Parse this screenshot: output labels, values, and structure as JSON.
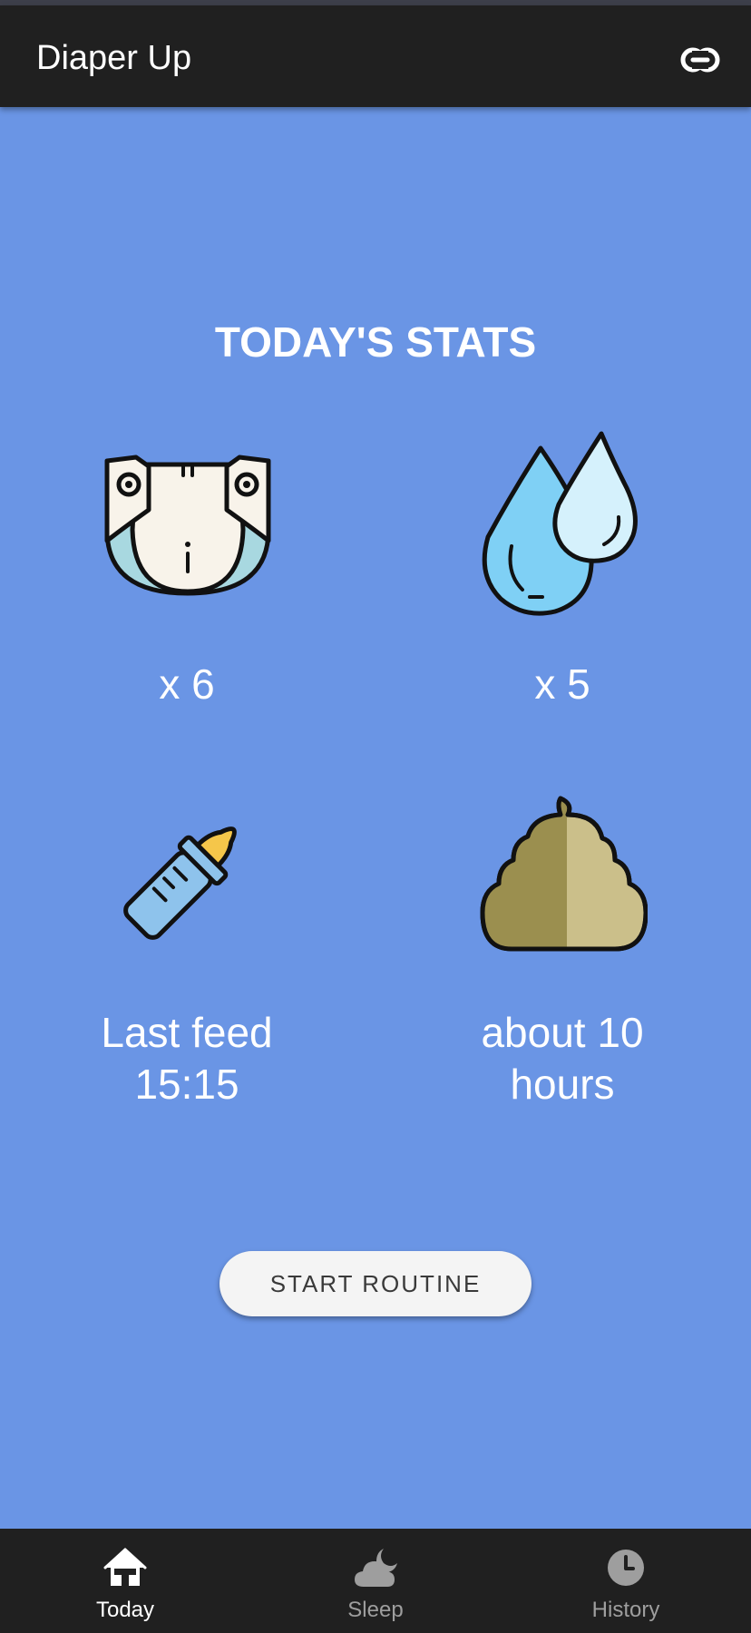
{
  "app_bar": {
    "title": "Diaper Up",
    "link_icon": "link-icon"
  },
  "main": {
    "heading": "TODAY'S STATS",
    "stats": [
      {
        "icon": "diaper-icon",
        "line1": "x 6",
        "line2": ""
      },
      {
        "icon": "water-drops-icon",
        "line1": "x 5",
        "line2": ""
      },
      {
        "icon": "baby-bottle-icon",
        "line1": "Last feed",
        "line2": "15:15"
      },
      {
        "icon": "poop-icon",
        "line1": "about 10",
        "line2": "hours"
      }
    ],
    "start_button": "START ROUTINE"
  },
  "bottom_nav": {
    "items": [
      {
        "label": "Today",
        "icon": "home-icon",
        "active": true
      },
      {
        "label": "Sleep",
        "icon": "cloud-moon-icon",
        "active": false
      },
      {
        "label": "History",
        "icon": "clock-icon",
        "active": false
      }
    ]
  },
  "colors": {
    "background": "#6a95e5",
    "app_bar": "#202020",
    "nav_active": "#ffffff",
    "nav_inactive": "#9e9e9e"
  }
}
